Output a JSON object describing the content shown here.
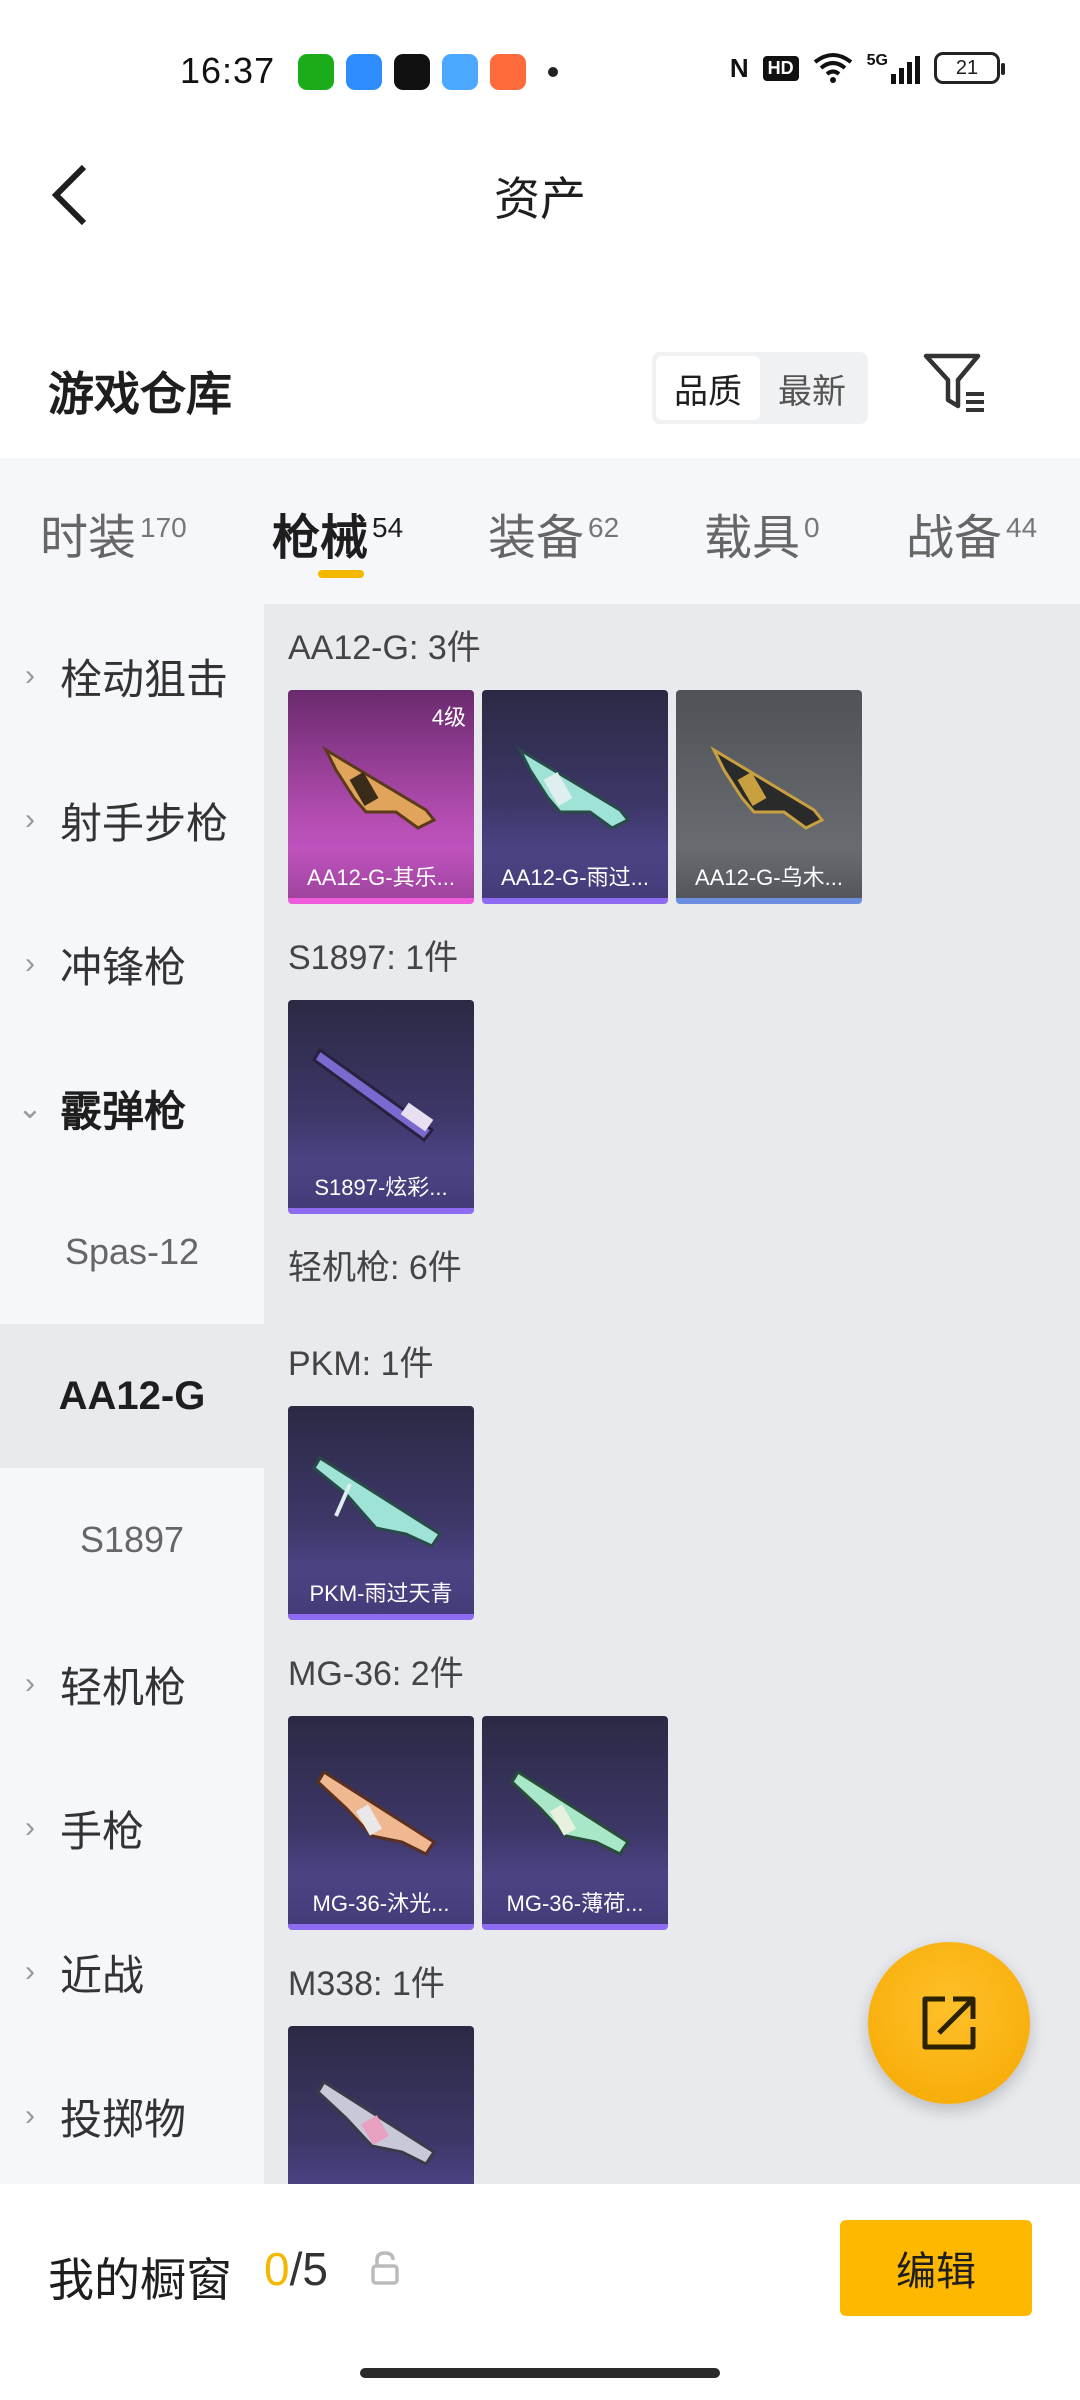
{
  "status_bar": {
    "time": "16:37",
    "app_icons": [
      {
        "icon": "wechat-icon",
        "color": "#1aad19"
      },
      {
        "icon": "app-blue-icon",
        "color": "#2f8cff"
      },
      {
        "icon": "tiktok-icon",
        "color": "#111111"
      },
      {
        "icon": "app-lightblue-icon",
        "color": "#4aa8ff"
      },
      {
        "icon": "game-controller-icon",
        "color": "#ff6a3a"
      }
    ],
    "nfc": "N",
    "hd": "HD",
    "network": "5G",
    "battery": "21"
  },
  "header": {
    "title": "资产",
    "back_icon": "chevron-left-icon"
  },
  "warehouse": {
    "title": "游戏仓库",
    "sort_options": [
      "品质",
      "最新"
    ],
    "active_sort": "品质",
    "filter_icon": "filter-icon"
  },
  "tabs": [
    {
      "label": "时装",
      "count": "170"
    },
    {
      "label": "枪械",
      "count": "54"
    },
    {
      "label": "装备",
      "count": "62"
    },
    {
      "label": "载具",
      "count": "0"
    },
    {
      "label": "战备",
      "count": "44"
    }
  ],
  "active_tab": "枪械",
  "sidebar": {
    "items": [
      {
        "label": "栓动狙击",
        "chevron": "›"
      },
      {
        "label": "射手步枪",
        "chevron": "›"
      },
      {
        "label": "冲锋枪",
        "chevron": "›"
      },
      {
        "label": "霰弹枪",
        "chevron": "⌄"
      },
      {
        "label": "轻机枪",
        "chevron": "›"
      },
      {
        "label": "手枪",
        "chevron": "›"
      },
      {
        "label": "近战",
        "chevron": "›"
      },
      {
        "label": "投掷物",
        "chevron": "›"
      }
    ],
    "subitems": [
      "Spas-12",
      "AA12-G",
      "S1897"
    ],
    "active_subitem": "AA12-G"
  },
  "groups": {
    "aa12": {
      "title": "AA12-G: 3件",
      "items": [
        {
          "name": "AA12-G-其乐...",
          "level": "4级",
          "rarity": "pink"
        },
        {
          "name": "AA12-G-雨过...",
          "rarity": "purple"
        },
        {
          "name": "AA12-G-乌木...",
          "rarity": "gray"
        }
      ]
    },
    "s1897": {
      "title": "S1897: 1件",
      "items": [
        {
          "name": "S1897-炫彩...",
          "rarity": "purple"
        }
      ]
    },
    "lmg_title": "轻机枪: 6件",
    "pkm": {
      "title": "PKM: 1件",
      "items": [
        {
          "name": "PKM-雨过天青",
          "rarity": "purple"
        }
      ]
    },
    "mg36": {
      "title": "MG-36: 2件",
      "items": [
        {
          "name": "MG-36-沐光...",
          "rarity": "purple"
        },
        {
          "name": "MG-36-薄荷...",
          "rarity": "purple"
        }
      ]
    },
    "m338": {
      "title": "M338: 1件",
      "items": [
        {
          "name": "",
          "rarity": "purple"
        }
      ]
    }
  },
  "fab_icon": "share-external-icon",
  "showcase": {
    "label": "我的橱窗",
    "current": "0",
    "separator": "/",
    "max": "5",
    "lock_icon": "lock-icon",
    "edit_label": "编辑"
  },
  "colors": {
    "accent": "#ffb800",
    "tab_underline": "#f5b800",
    "sidebar_bg": "#f5f7fa",
    "content_bg": "#e8eaee"
  }
}
